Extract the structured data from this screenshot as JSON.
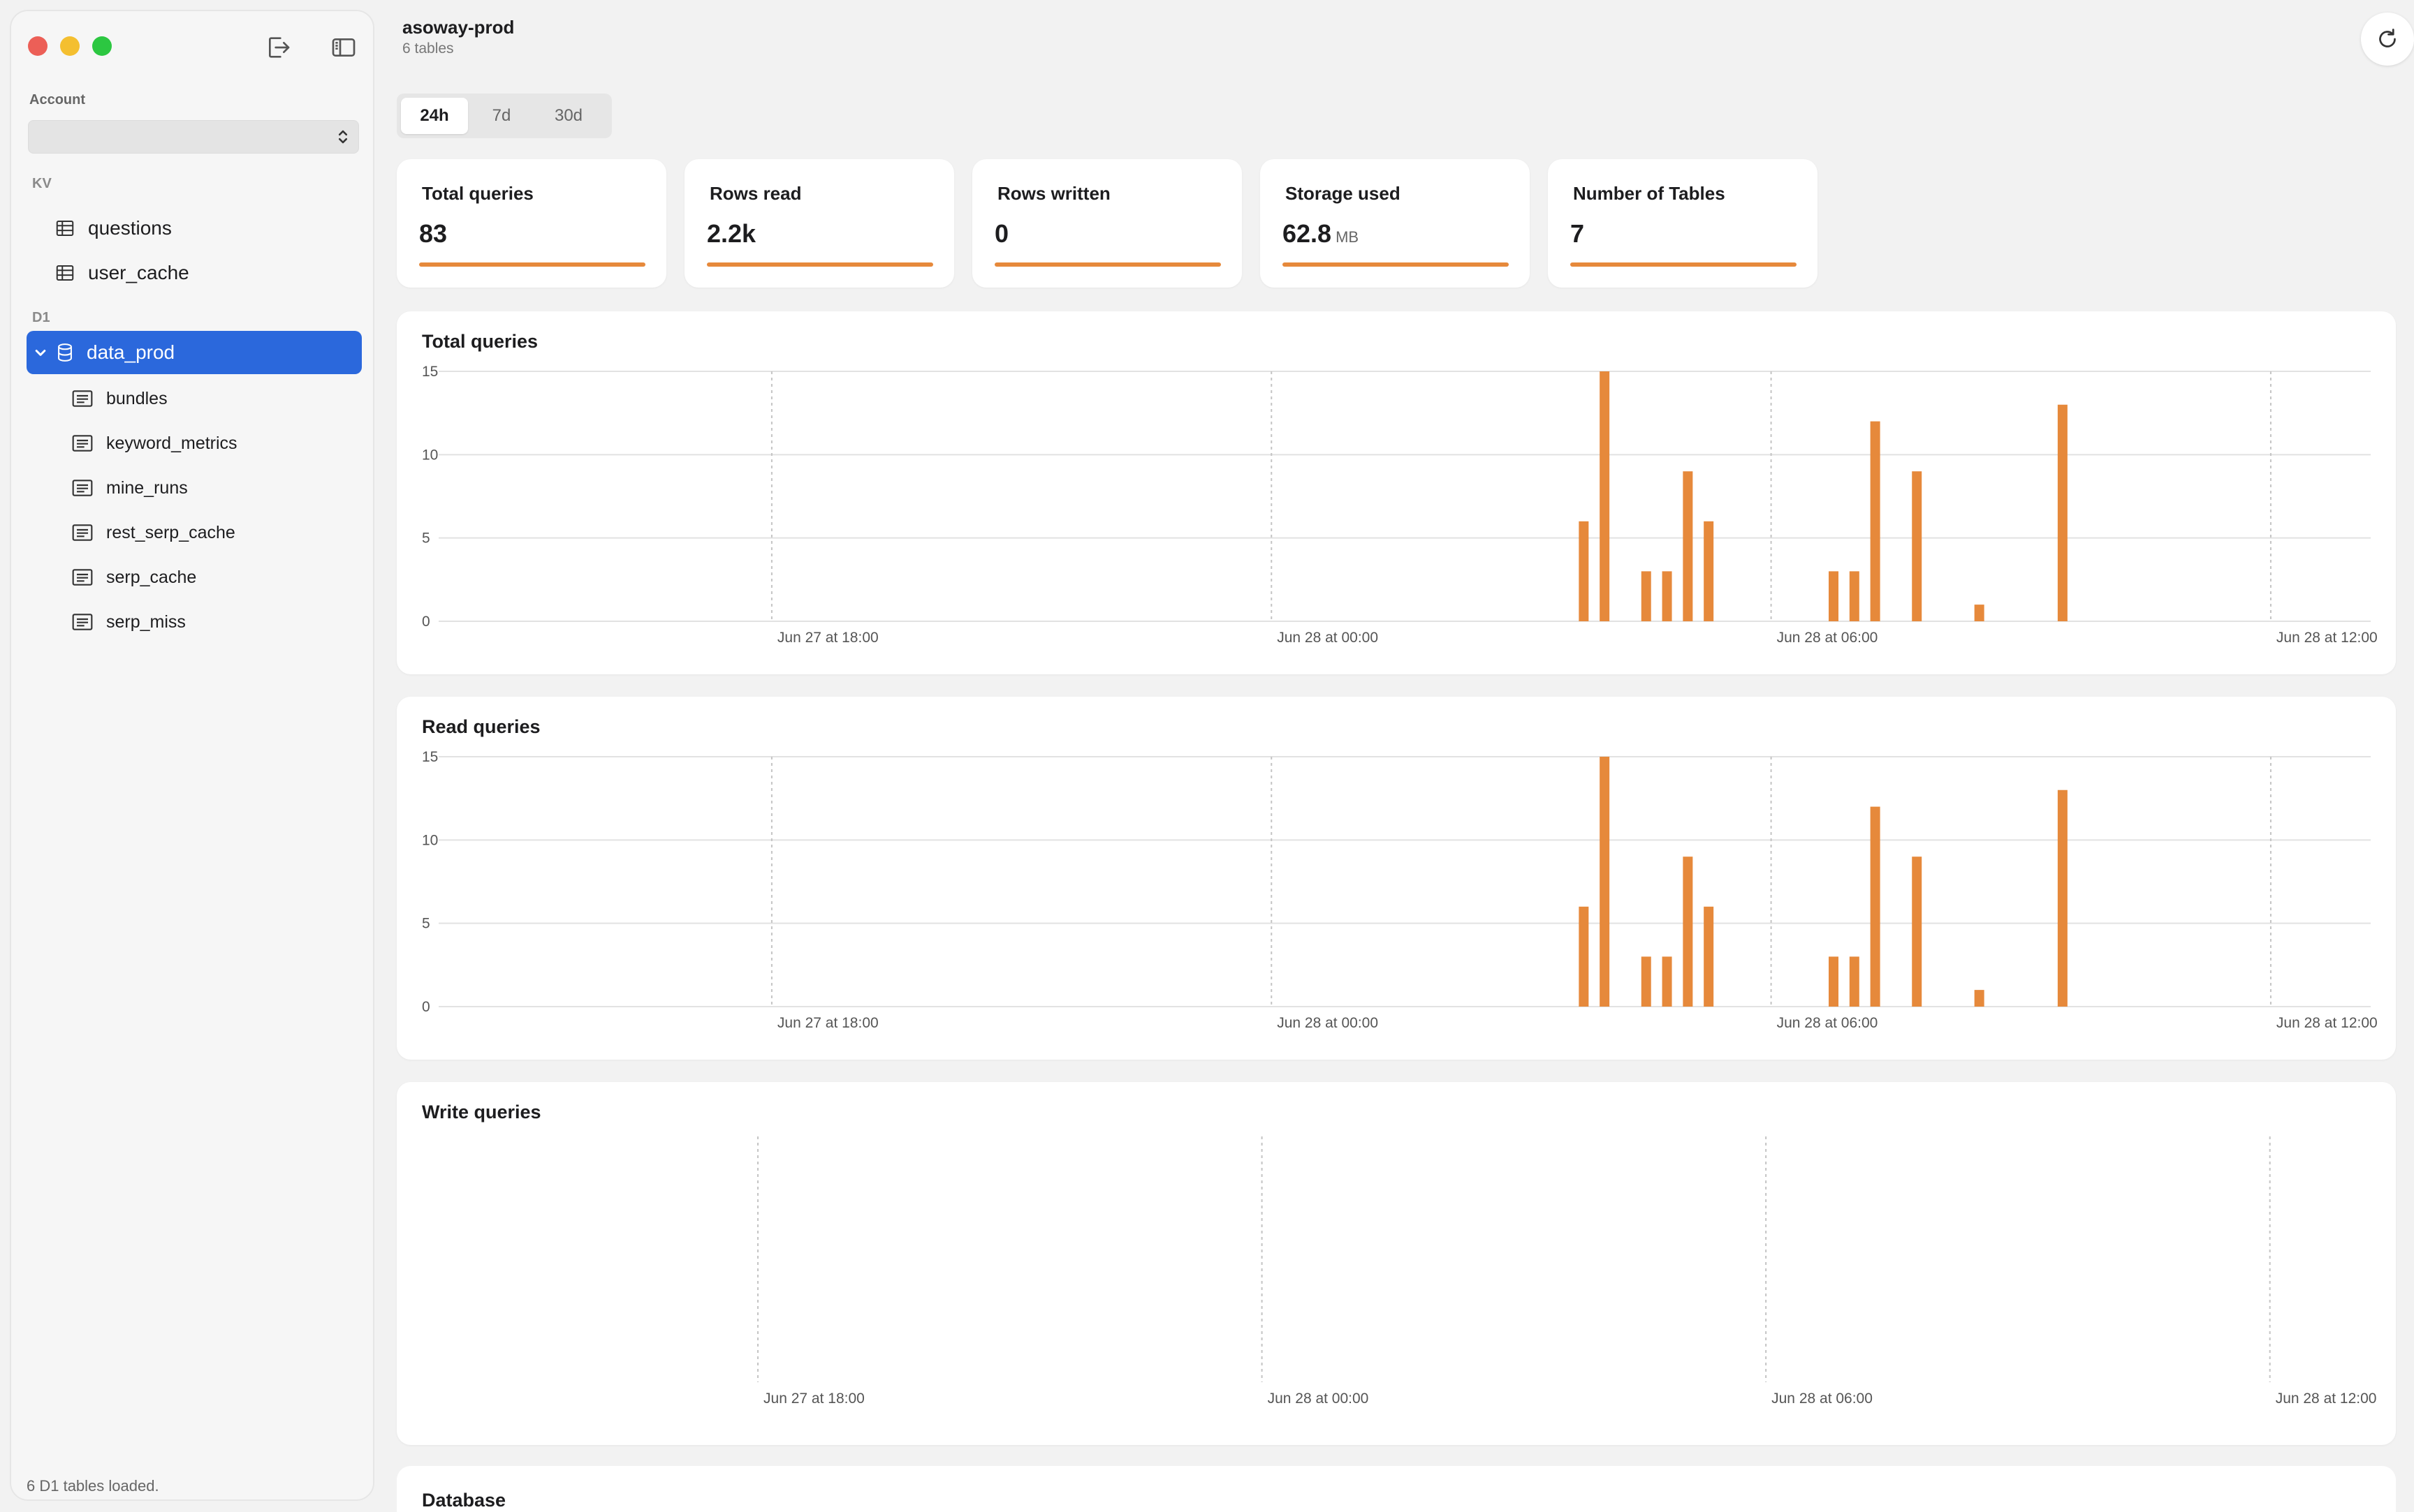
{
  "sidebar": {
    "account_label": "Account",
    "account_value": "",
    "kv_label": "KV",
    "kv_items": [
      "questions",
      "user_cache"
    ],
    "d1_label": "D1",
    "database": "data_prod",
    "tables": [
      "bundles",
      "keyword_metrics",
      "mine_runs",
      "rest_serp_cache",
      "serp_cache",
      "serp_miss"
    ],
    "status": "6 D1 tables loaded."
  },
  "header": {
    "title": "asoway-prod",
    "subtitle": "6 tables"
  },
  "ranges": [
    "24h",
    "7d",
    "30d"
  ],
  "active_range": "24h",
  "stats": [
    {
      "label": "Total queries",
      "value": "83",
      "unit": ""
    },
    {
      "label": "Rows read",
      "value": "2.2k",
      "unit": ""
    },
    {
      "label": "Rows written",
      "value": "0",
      "unit": ""
    },
    {
      "label": "Storage used",
      "value": "62.8",
      "unit": "MB"
    },
    {
      "label": "Number of Tables",
      "value": "7",
      "unit": ""
    }
  ],
  "colors": {
    "accent": "#e6893b",
    "selection": "#2b68dc"
  },
  "chart_data": [
    {
      "type": "bar",
      "title": "Total queries",
      "ylim": [
        0,
        15
      ],
      "yticks": [
        0,
        5,
        10,
        15
      ],
      "xticks": [
        "Jun 27 at 18:00",
        "Jun 28 at 00:00",
        "Jun 28 at 06:00",
        "Jun 28 at 12:00"
      ],
      "xrange_hours": [
        -4,
        19.2
      ],
      "x": [
        9.75,
        10.0,
        10.5,
        10.75,
        11.0,
        11.25,
        12.75,
        13.0,
        13.25,
        13.75,
        14.5,
        15.5
      ],
      "values": [
        6,
        15,
        3,
        3,
        9,
        6,
        3,
        3,
        12,
        9,
        1,
        13
      ]
    },
    {
      "type": "bar",
      "title": "Read queries",
      "ylim": [
        0,
        15
      ],
      "yticks": [
        0,
        5,
        10,
        15
      ],
      "xticks": [
        "Jun 27 at 18:00",
        "Jun 28 at 00:00",
        "Jun 28 at 06:00",
        "Jun 28 at 12:00"
      ],
      "xrange_hours": [
        -4,
        19.2
      ],
      "x": [
        9.75,
        10.0,
        10.5,
        10.75,
        11.0,
        11.25,
        12.75,
        13.0,
        13.25,
        13.75,
        14.5,
        15.5
      ],
      "values": [
        6,
        15,
        3,
        3,
        9,
        6,
        3,
        3,
        12,
        9,
        1,
        13
      ]
    },
    {
      "type": "bar",
      "title": "Write queries",
      "ylim": null,
      "yticks": [],
      "xticks": [
        "Jun 27 at 18:00",
        "Jun 28 at 00:00",
        "Jun 28 at 06:00",
        "Jun 28 at 12:00"
      ],
      "xrange_hours": [
        -4,
        19.2
      ],
      "x": [],
      "values": []
    }
  ],
  "database_section": {
    "title": "Database"
  }
}
